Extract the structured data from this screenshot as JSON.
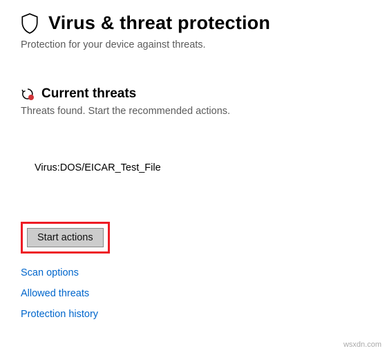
{
  "header": {
    "title": "Virus & threat protection",
    "subtitle": "Protection for your device against threats."
  },
  "threats_section": {
    "title": "Current threats",
    "subtitle": "Threats found. Start the recommended actions.",
    "items": [
      {
        "name": "Virus:DOS/EICAR_Test_File"
      }
    ]
  },
  "actions": {
    "start_label": "Start actions"
  },
  "links": {
    "scan_options": "Scan options",
    "allowed_threats": "Allowed threats",
    "protection_history": "Protection history"
  },
  "watermark": "wsxdn.com"
}
